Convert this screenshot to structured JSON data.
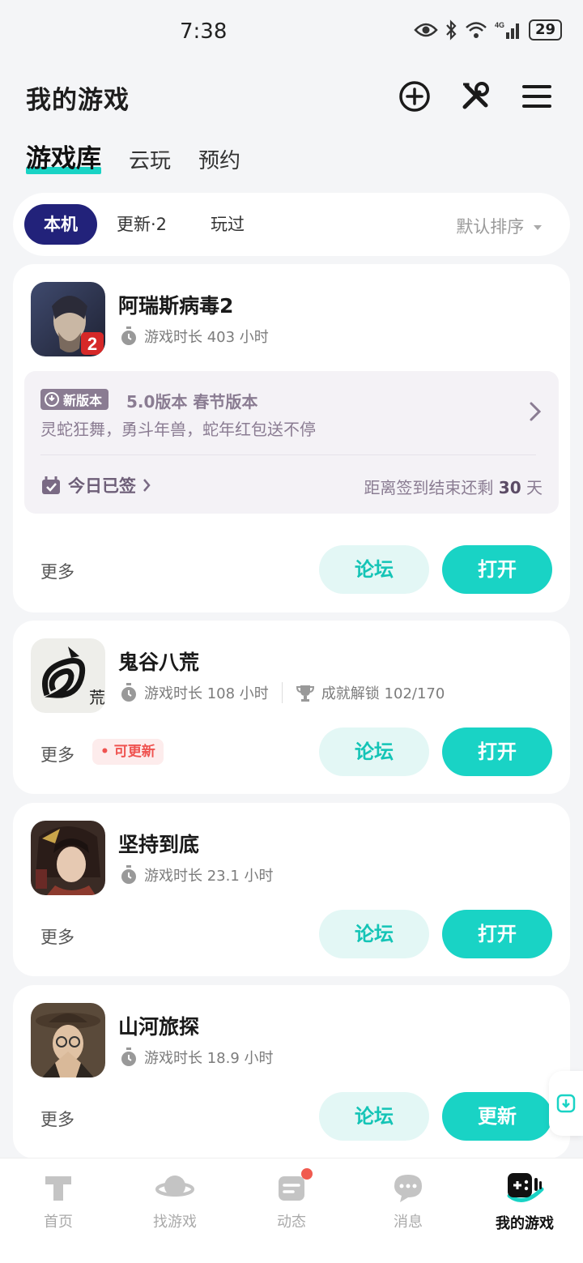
{
  "status": {
    "time": "7:38",
    "battery": "29"
  },
  "header": {
    "title": "我的游戏"
  },
  "tabs": [
    {
      "label": "游戏库"
    },
    {
      "label": "云玩"
    },
    {
      "label": "预约"
    }
  ],
  "filter": {
    "chips": [
      {
        "label": "本机"
      },
      {
        "label": "更新·2"
      },
      {
        "label": "玩过"
      }
    ],
    "sort": "默认排序"
  },
  "games": [
    {
      "name": "阿瑞斯病毒2",
      "playtime": "游戏时长 403 小时",
      "promo": {
        "badge": "新版本",
        "title": "5.0版本 春节版本",
        "desc": "灵蛇狂舞，勇斗年兽，蛇年红包送不停",
        "checkin": "今日已签",
        "remain_prefix": "距离签到结束还剩",
        "remain_days": "30",
        "remain_suffix": "天"
      },
      "more": "更多",
      "forum": "论坛",
      "action": "打开"
    },
    {
      "name": "鬼谷八荒",
      "playtime": "游戏时长 108 小时",
      "achievement": "成就解锁 102/170",
      "badge": "可更新",
      "more": "更多",
      "forum": "论坛",
      "action": "打开"
    },
    {
      "name": "坚持到底",
      "playtime": "游戏时长 23.1 小时",
      "more": "更多",
      "forum": "论坛",
      "action": "打开"
    },
    {
      "name": "山河旅探",
      "playtime": "游戏时长 18.9 小时",
      "more": "更多",
      "forum": "论坛",
      "action": "更新"
    }
  ],
  "nav": [
    {
      "label": "首页",
      "icon": "home-icon"
    },
    {
      "label": "找游戏",
      "icon": "planet-icon"
    },
    {
      "label": "动态",
      "icon": "feed-icon"
    },
    {
      "label": "消息",
      "icon": "message-icon"
    },
    {
      "label": "我的游戏",
      "icon": "gamepad-icon"
    }
  ],
  "colors": {
    "accent": "#19d3c5",
    "chip_active": "#22227a",
    "update_red": "#ef5350"
  }
}
